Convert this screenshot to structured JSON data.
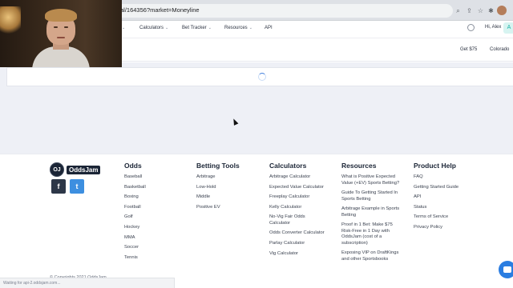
{
  "browser": {
    "url_text": "al/164356?market=Moneyline",
    "icons": [
      "search-icon",
      "share-icon",
      "star-icon",
      "extension-icon",
      "extensions-puzzle-icon",
      "profile-icon"
    ]
  },
  "nav": {
    "items": [
      {
        "label": "Calculators",
        "has_caret": true
      },
      {
        "label": "Bet Tracker",
        "has_caret": true
      },
      {
        "label": "Resources",
        "has_caret": true
      },
      {
        "label": "API",
        "has_caret": false
      }
    ],
    "caret_glyph": "⌄",
    "user_greeting": "Hi, Alex",
    "avatar_initial": "A"
  },
  "subnav": {
    "get_label": "Get $75",
    "state_label": "Colorado"
  },
  "footer": {
    "logo_text": "OddsJam",
    "logo_mark": "OJ",
    "social": [
      {
        "name": "facebook-icon",
        "glyph": "f"
      },
      {
        "name": "twitter-icon",
        "glyph": "t"
      }
    ],
    "columns": [
      {
        "heading": "Odds",
        "links": [
          "Baseball",
          "Basketball",
          "Boxing",
          "Football",
          "Golf",
          "Hockey",
          "MMA",
          "Soccer",
          "Tennis"
        ]
      },
      {
        "heading": "Betting Tools",
        "links": [
          "Arbitrage",
          "Low-Hold",
          "Middle",
          "Positive EV"
        ]
      },
      {
        "heading": "Calculators",
        "links": [
          "Arbitrage Calculator",
          "Expected Value Calculator",
          "Freeplay Calculator",
          "Kelly Calculator",
          "No-Vig Fair Odds Calculator",
          "Odds Converter Calculator",
          "Parlay Calculator",
          "Vig Calculator"
        ]
      },
      {
        "heading": "Resources",
        "links": [
          "What is Positive Expected Value (+EV) Sports Betting?",
          "Guide To Getting Started In Sports Betting",
          "Arbitrage Example in Sports Betting",
          "Proof in 1 Bet: Make $75 Risk-Free in 1 Day with OddsJam (cost of a subscription)",
          "Exposing VIP on DraftKings and other Sportsbooks"
        ]
      },
      {
        "heading": "Product Help",
        "links": [
          "FAQ",
          "Getting Started Guide",
          "API",
          "Status",
          "Terms of Service",
          "Privacy Policy"
        ]
      }
    ],
    "copyright": "© Copyrights 2021 OddsJam"
  },
  "status_bar": {
    "text": "Waiting for api-2.oddsjam.com..."
  },
  "colors": {
    "accent": "#3b7bdc",
    "page_bg": "#eef0f6",
    "twitter": "#3d8fe0",
    "avatar_bg": "#d7f4f1"
  }
}
